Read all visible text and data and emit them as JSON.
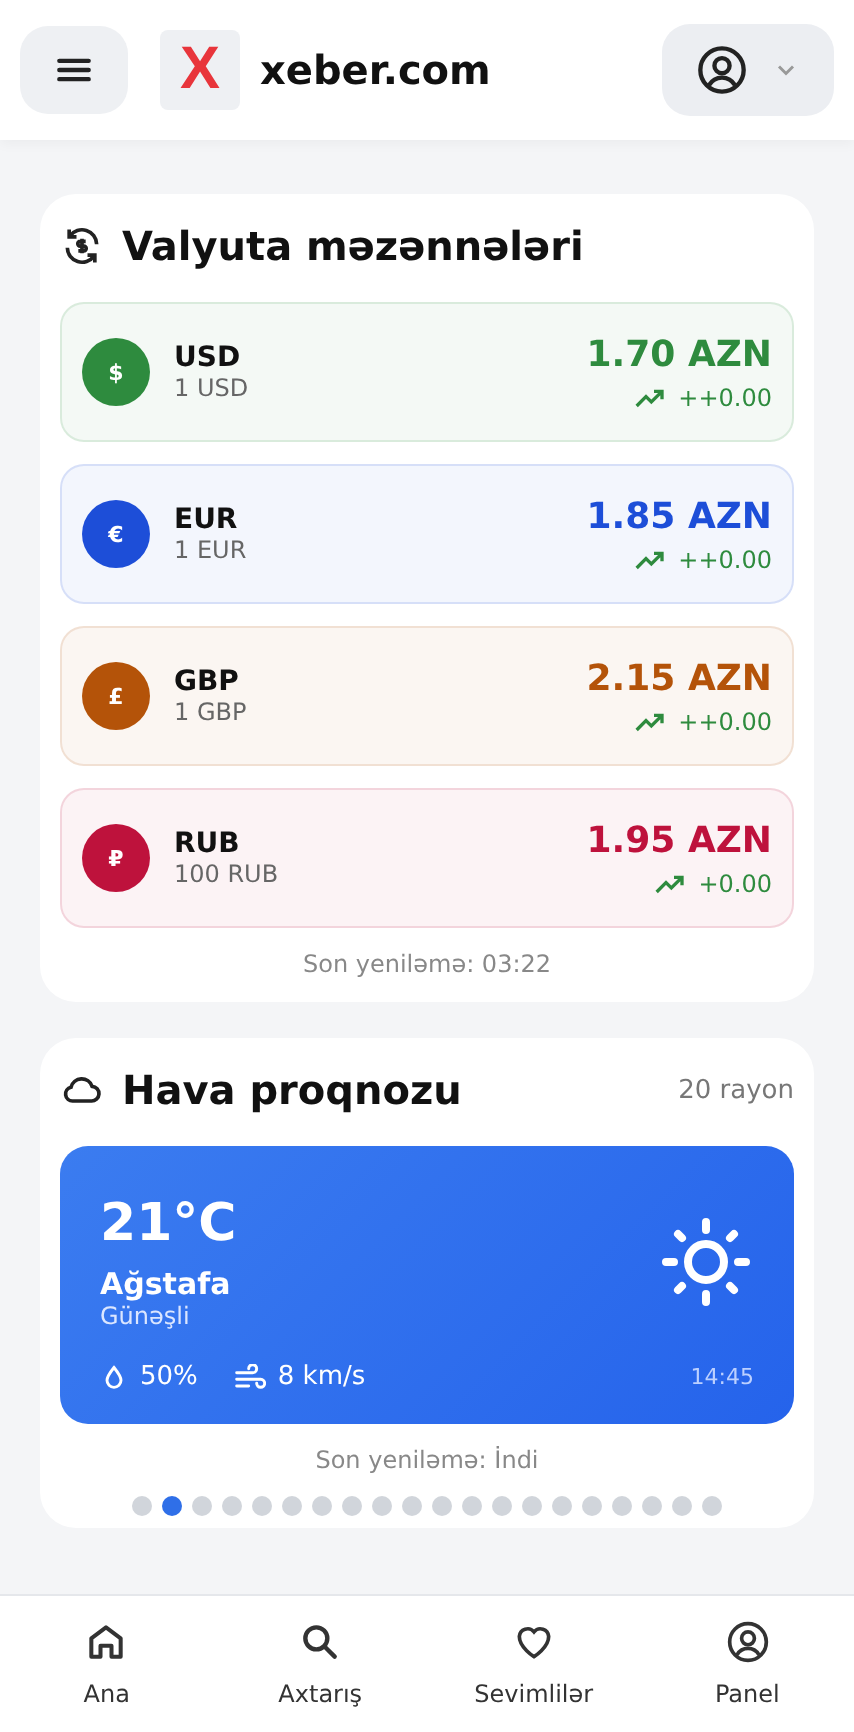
{
  "header": {
    "site_name": "xeber.com",
    "logo_letter": "X"
  },
  "currency": {
    "title": "Valyuta məzənnələri",
    "rates": [
      {
        "code": "USD",
        "amount": "1 USD",
        "symbol": "$",
        "value": "1.70 AZN",
        "change": "++0.00",
        "color": "#2e8b3e"
      },
      {
        "code": "EUR",
        "amount": "1 EUR",
        "symbol": "€",
        "value": "1.85 AZN",
        "change": "++0.00",
        "color": "#1d4ed8"
      },
      {
        "code": "GBP",
        "amount": "1 GBP",
        "symbol": "£",
        "value": "2.15 AZN",
        "change": "++0.00",
        "color": "#b45309"
      },
      {
        "code": "RUB",
        "amount": "100 RUB",
        "symbol": "₽",
        "value": "1.95 AZN",
        "change": "+0.00",
        "color": "#be123c"
      }
    ],
    "updated": "Son yeniləmə: 03:22"
  },
  "weather": {
    "title": "Hava proqnozu",
    "count": "20 rayon",
    "temperature": "21°C",
    "city": "Ağstafa",
    "condition": "Günəşli",
    "humidity": "50%",
    "wind": "8 km/s",
    "time": "14:45",
    "updated": "Son yeniləmə: İndi",
    "dots": [
      {
        "selected": false
      },
      {
        "selected": true
      },
      {
        "selected": false
      },
      {
        "selected": false
      },
      {
        "selected": false
      },
      {
        "selected": false
      },
      {
        "selected": false
      },
      {
        "selected": false
      },
      {
        "selected": false
      },
      {
        "selected": false
      },
      {
        "selected": false
      },
      {
        "selected": false
      },
      {
        "selected": false
      },
      {
        "selected": false
      },
      {
        "selected": false
      },
      {
        "selected": false
      },
      {
        "selected": false
      },
      {
        "selected": false
      },
      {
        "selected": false
      },
      {
        "selected": false
      }
    ]
  },
  "bottom_nav": [
    {
      "label": "Ana",
      "kind": "home"
    },
    {
      "label": "Axtarış",
      "kind": "search"
    },
    {
      "label": "Sevimlilər",
      "kind": "heart"
    },
    {
      "label": "Panel",
      "kind": "user"
    }
  ]
}
